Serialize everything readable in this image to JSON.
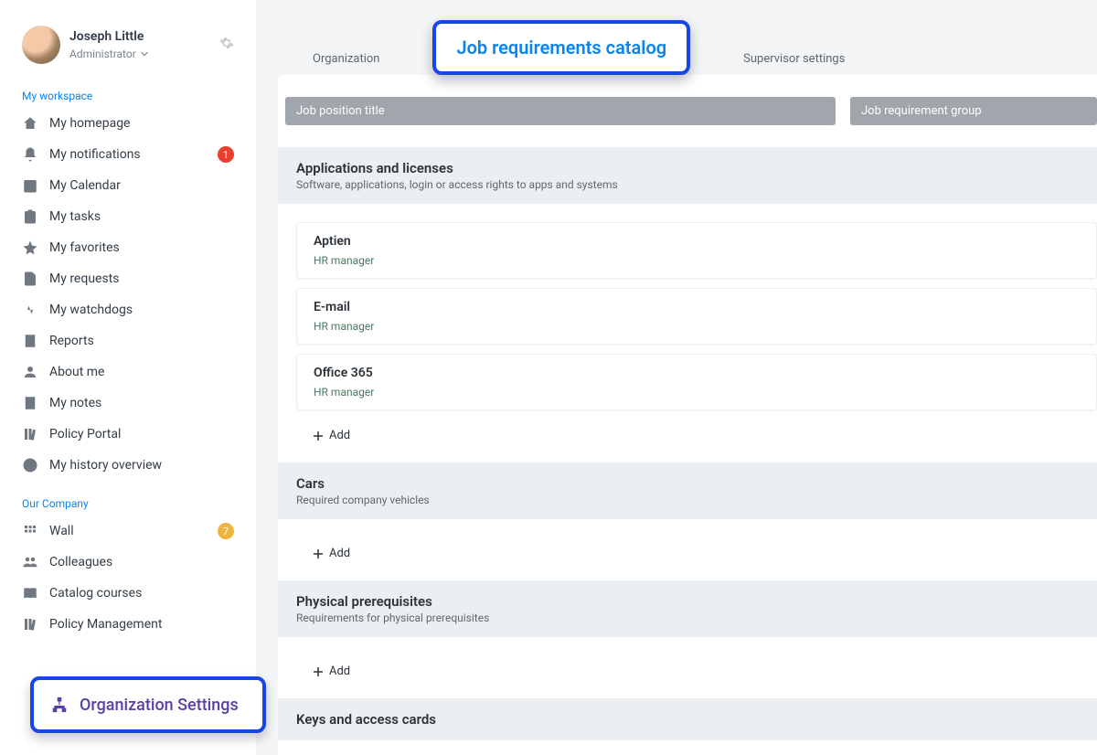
{
  "profile": {
    "name": "Joseph Little",
    "role": "Administrator"
  },
  "sidebar": {
    "section1_label": "My workspace",
    "section2_label": "Our Company",
    "items1": [
      {
        "label": "My homepage"
      },
      {
        "label": "My notifications",
        "badge_red": "1"
      },
      {
        "label": "My Calendar"
      },
      {
        "label": "My tasks"
      },
      {
        "label": "My favorites"
      },
      {
        "label": "My requests"
      },
      {
        "label": "My watchdogs"
      },
      {
        "label": "Reports"
      },
      {
        "label": "About me"
      },
      {
        "label": "My notes"
      },
      {
        "label": "Policy Portal"
      },
      {
        "label": "My history overview"
      }
    ],
    "items2": [
      {
        "label": "Wall",
        "badge_yellow": "7"
      },
      {
        "label": "Colleagues"
      },
      {
        "label": "Catalog courses"
      },
      {
        "label": "Policy Management"
      }
    ],
    "org_settings_label": "Organization Settings"
  },
  "tabs": {
    "org": "Organization",
    "catalog": "Job requirements catalog",
    "supervisor": "Supervisor settings"
  },
  "headers": {
    "title": "Job position title",
    "group": "Job requirement group"
  },
  "groups": [
    {
      "title": "Applications and licenses",
      "subtitle": "Software, applications, login or access rights to apps and systems",
      "items": [
        {
          "title": "Aptien",
          "sub": "HR manager"
        },
        {
          "title": "E-mail",
          "sub": "HR manager"
        },
        {
          "title": "Office 365",
          "sub": "HR manager"
        }
      ],
      "add": "Add"
    },
    {
      "title": "Cars",
      "subtitle": "Required company vehicles",
      "items": [],
      "add": "Add"
    },
    {
      "title": "Physical prerequisites",
      "subtitle": "Requirements for physical prerequisites",
      "items": [],
      "add": "Add"
    },
    {
      "title": "Keys and access cards",
      "subtitle": "",
      "items": [],
      "add": ""
    }
  ]
}
